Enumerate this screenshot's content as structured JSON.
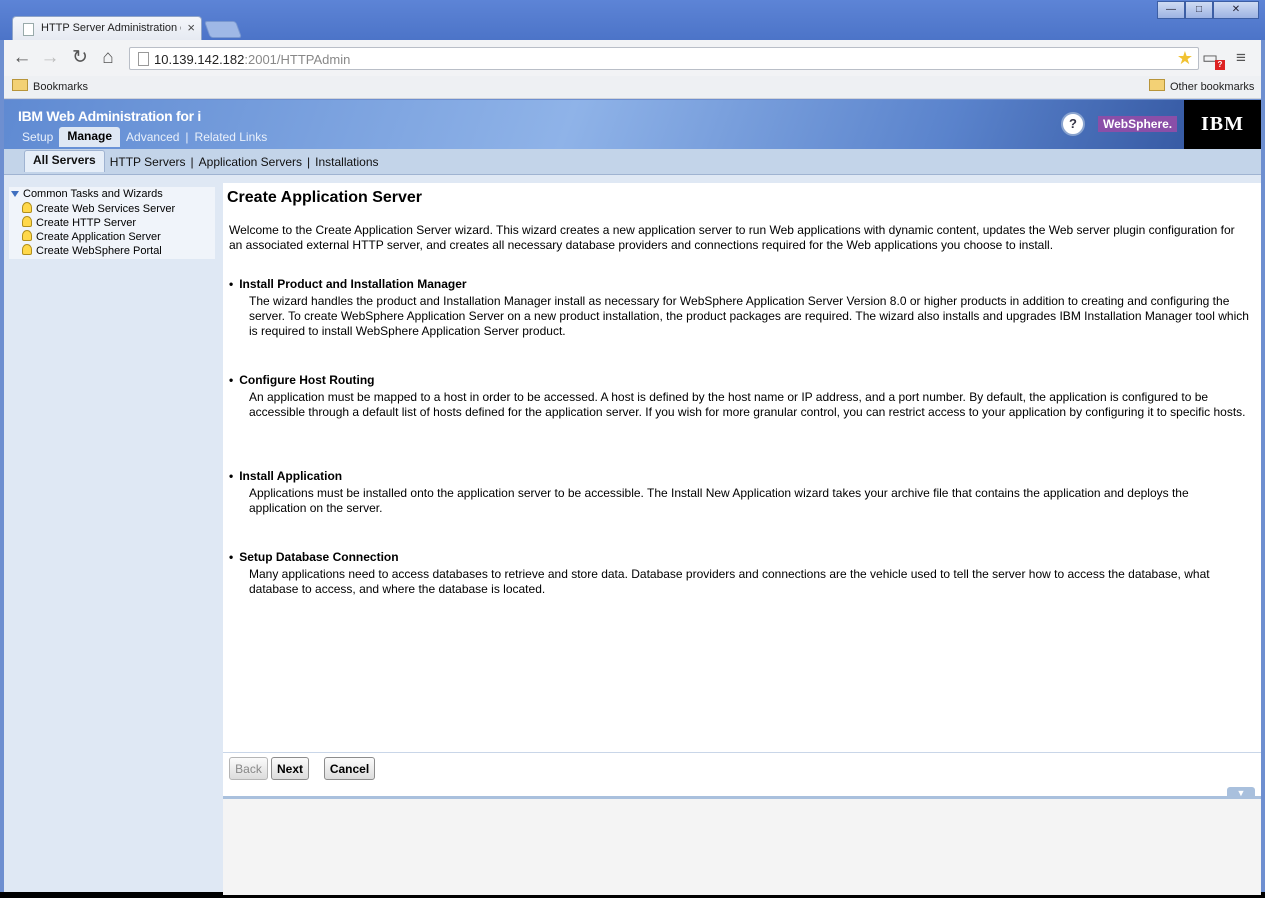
{
  "browser": {
    "tab_title": "HTTP Server Administration on",
    "url_host": "10.139.142.182",
    "url_rest": ":2001/HTTPAdmin",
    "bookmarks_label": "Bookmarks",
    "other_bookmarks_label": "Other bookmarks",
    "badge_text": "?"
  },
  "header": {
    "app_title": "IBM Web Administration for i",
    "tabs": [
      "Setup",
      "Manage",
      "Advanced",
      "Related Links"
    ],
    "active_tab": "Manage",
    "help_symbol": "?",
    "websphere_label": "WebSphere.",
    "ibm_logo": "IBM"
  },
  "subnav": {
    "tabs": [
      "All Servers",
      "HTTP Servers",
      "Application Servers",
      "Installations"
    ]
  },
  "sidebar": {
    "group": "Common Tasks and Wizards",
    "items": [
      "Create Web Services Server",
      "Create HTTP Server",
      "Create Application Server",
      "Create WebSphere Portal"
    ]
  },
  "main": {
    "title": "Create Application Server",
    "intro": "Welcome to the Create Application Server wizard. This wizard creates a new application server to run Web applications with dynamic content, updates the Web server plugin configuration for an associated external HTTP server, and creates all necessary database providers and connections required for the Web applications you choose to install.",
    "sections": [
      {
        "heading": "Install Product and Installation Manager",
        "text": "The wizard handles the product and Installation Manager install as necessary for WebSphere Application Server Version 8.0 or higher products in addition to creating and configuring the server. To create WebSphere Application Server on a new product installation, the product packages are required. The wizard also installs and upgrades IBM Installation Manager tool which is required to install WebSphere Application Server product."
      },
      {
        "heading": "Configure Host Routing",
        "text": "An application must be mapped to a host in order to be accessed. A host is defined by the host name or IP address, and a port number. By default, the application is configured to be accessible through a default list of hosts defined for the application server. If you wish for more granular control, you can restrict access to your application by configuring it to specific hosts."
      },
      {
        "heading": "Install Application",
        "text": "Applications must be installed onto the application server to be accessible. The Install New Application wizard takes your archive file that contains the application and deploys the application on the server."
      },
      {
        "heading": "Setup Database Connection",
        "text": "Many applications need to access databases to retrieve and store data. Database providers and connections are the vehicle used to tell the server how to access the database, what database to access, and where the database is located."
      }
    ],
    "buttons": {
      "back": "Back",
      "next": "Next",
      "cancel": "Cancel"
    }
  }
}
